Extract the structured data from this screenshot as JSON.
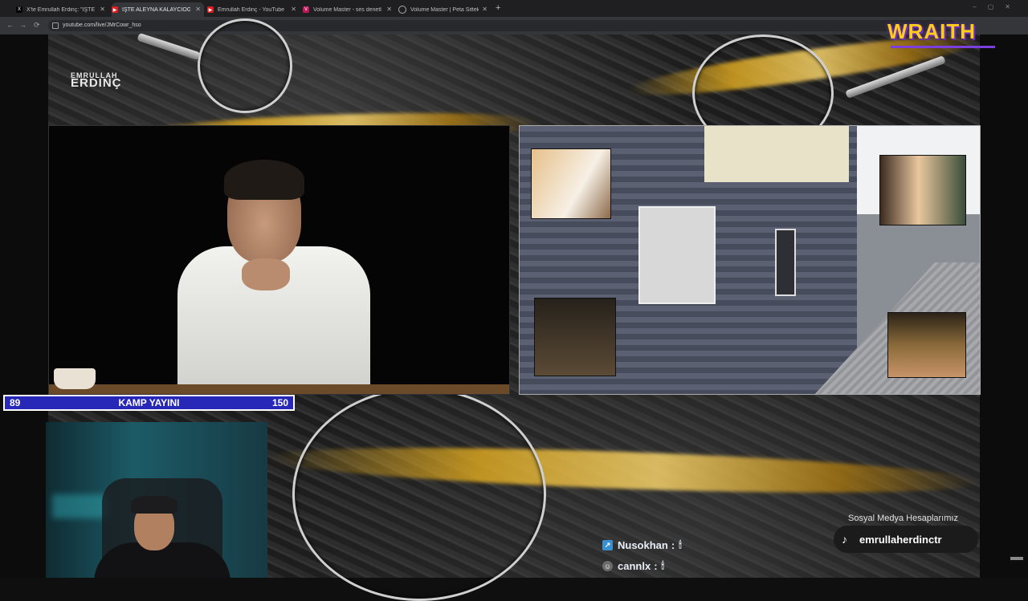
{
  "browser": {
    "tabs": [
      {
        "title": "X'te Emrullah Erdinç: \"İŞTE ALEYNA",
        "icon": "x-icon",
        "active": false
      },
      {
        "title": "İŞTE ALEYNA KALAYCIOĞLU",
        "icon": "youtube-icon",
        "active": true
      },
      {
        "title": "Emrullah Erdinç - YouTube",
        "icon": "youtube-icon",
        "active": false
      },
      {
        "title": "Volume Master - ses denetleyici",
        "icon": "volume-master-icon",
        "active": false
      },
      {
        "title": "Volume Master | Peta Sittek",
        "icon": "globe-icon",
        "active": false
      }
    ],
    "url": "youtube.com/live/JMrCowr_hso"
  },
  "overlay": {
    "brand_top": "EMRULLAH",
    "brand_bottom": "ERDINÇ",
    "sponsor_logo": "WRAITH",
    "ticker": {
      "left_number": "89",
      "title": "KAMP YAYINI",
      "right_number": "150"
    },
    "social": {
      "label": "Sosyal Medya Hesaplarımız",
      "handle": "emrullaherdinctr"
    },
    "chat": [
      {
        "user": "Nusokhan",
        "suffix": ":",
        "emoji": "🕯"
      },
      {
        "user": "cannlx",
        "suffix": ":",
        "emoji": "🕯"
      }
    ]
  },
  "colors": {
    "ticker_bg": "#2828b8",
    "gold": "#d9a520",
    "wraith_yellow": "#ffcc19",
    "wraith_purple": "#7b3fe0"
  }
}
